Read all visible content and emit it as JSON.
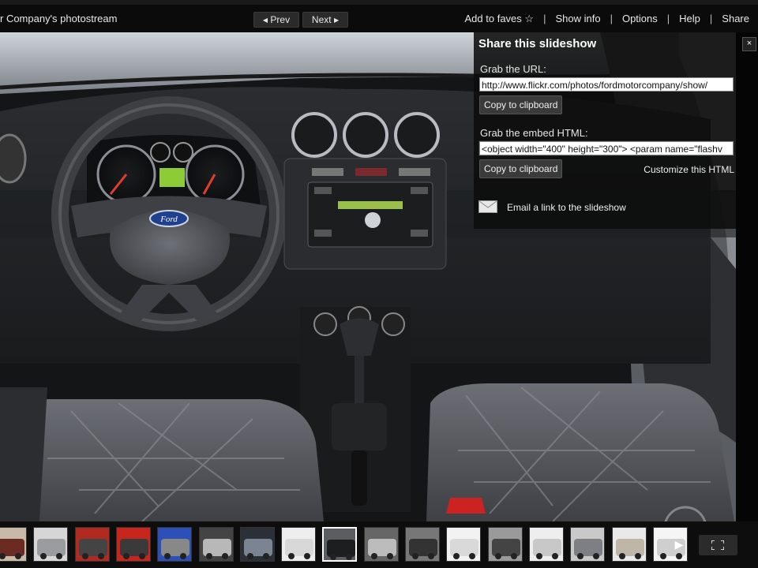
{
  "header": {
    "stream_title": "r Company's photostream",
    "prev_label": "Prev",
    "next_label": "Next",
    "add_to_faves": "Add to faves",
    "show_info": "Show info",
    "options": "Options",
    "help": "Help",
    "share": "Share",
    "separator": "|"
  },
  "share_panel": {
    "title": "Share this slideshow",
    "url_label": "Grab the URL:",
    "url_value": "http://www.flickr.com/photos/fordmotorcompany/show/",
    "copy_label": "Copy to clipboard",
    "embed_label": "Grab the embed HTML:",
    "embed_value": "<object width=\"400\" height=\"300\"> <param name=\"flashv",
    "copy_label_2": "Copy to clipboard",
    "customize_label": "Customize this HTML",
    "email_label": "Email a link to the slideshow",
    "close_symbol": "×"
  },
  "photo": {
    "steering_badge": "Ford"
  },
  "filmstrip": {
    "thumbnail_count": 17,
    "active_index": 8
  },
  "icons": [
    "star-icon",
    "close-icon",
    "envelope-icon",
    "chevron-right-icon",
    "fullscreen-icon",
    "prev-arrow-icon",
    "next-arrow-icon"
  ]
}
